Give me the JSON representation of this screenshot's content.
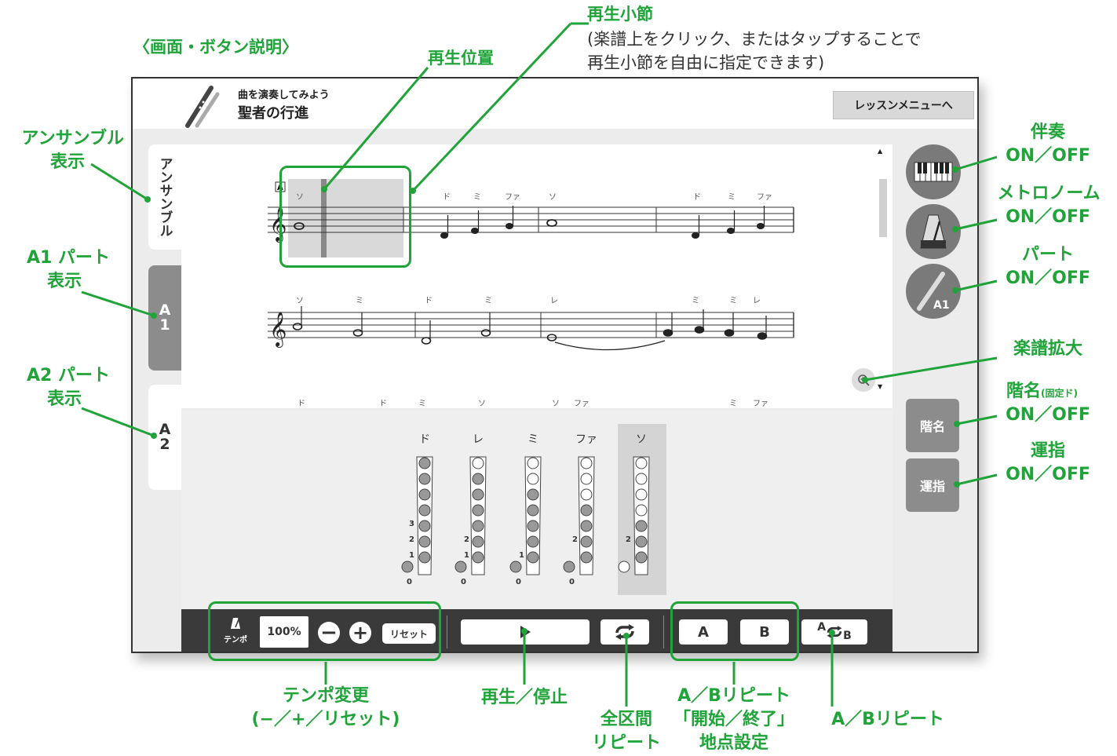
{
  "doc": {
    "heading": "〈画面・ボタン説明〉",
    "play_measure_title": "再生小節",
    "play_measure_note_1": "(楽譜上をクリック、またはタップすることで",
    "play_measure_note_2": "再生小節を自由に指定できます)",
    "play_position": "再生位置"
  },
  "app": {
    "subtitle": "曲を演奏してみよう",
    "title": "聖者の行進",
    "menu_button": "レッスンメニューへ"
  },
  "tabs": {
    "ensemble": "アンサンブル",
    "a1_top": "A",
    "a1_bottom": "1",
    "a2_top": "A",
    "a2_bottom": "2"
  },
  "score": {
    "rehearsal_mark": "A",
    "row1_names": [
      "ソ",
      "ド",
      "ミ",
      "ファ",
      "ソ",
      "ド",
      "ミ",
      "ファ"
    ],
    "row2_names": [
      "ソ",
      "ミ",
      "ド",
      "ミ",
      "レ",
      "ミ",
      "ミ",
      "レ"
    ],
    "row3_names": [
      "ド",
      "ド",
      "ミ",
      "ソ",
      "ソ",
      "ファ",
      "ミ",
      "ファ"
    ]
  },
  "fingering": {
    "notes": [
      {
        "name": "ド",
        "closed": 7,
        "thumb": "closed",
        "highlight": false
      },
      {
        "name": "レ",
        "closed": 6,
        "thumb": "closed",
        "highlight": false
      },
      {
        "name": "ミ",
        "closed": 5,
        "thumb": "closed",
        "highlight": false
      },
      {
        "name": "ファ",
        "closed": 4,
        "thumb": "closed",
        "highlight": false
      },
      {
        "name": "ソ",
        "closed": 3,
        "thumb": "open",
        "highlight": true
      }
    ],
    "labels": [
      "3",
      "2",
      "1",
      "0"
    ]
  },
  "buttons": {
    "scale_name": "階名",
    "fingering": "運指",
    "part_badge": "A1"
  },
  "toolbar": {
    "tempo_label": "テンポ",
    "tempo_value": "100%",
    "reset": "リセット",
    "a": "A",
    "b": "B",
    "ab_a": "A",
    "ab_b": "B"
  },
  "annotations": {
    "ensemble_1": "アンサンブル",
    "ensemble_2": "表示",
    "a1_1": "A1 パート",
    "a1_2": "表示",
    "a2_1": "A2 パート",
    "a2_2": "表示",
    "accomp_1": "伴奏",
    "accomp_2": "ON／OFF",
    "metro_1": "メトロノーム",
    "metro_2": "ON／OFF",
    "part_1": "パート",
    "part_2": "ON／OFF",
    "zoom": "楽譜拡大",
    "scale_1": "階名",
    "scale_small": "(固定ド)",
    "scale_2": "ON／OFF",
    "finger_1": "運指",
    "finger_2": "ON／OFF",
    "tempo_1": "テンポ変更",
    "tempo_2": "(−／+／リセット)",
    "play": "再生／停止",
    "full_1": "全区間",
    "full_2": "リピート",
    "abset_1": "A／Bリピート",
    "abset_2": "「開始／終了」",
    "abset_3": "地点設定",
    "ab": "A／Bリピート"
  },
  "colors": {
    "accent": "#20a43a",
    "panel": "#ececec",
    "button": "#8c8c8c",
    "bar": "#3a3a3a"
  }
}
